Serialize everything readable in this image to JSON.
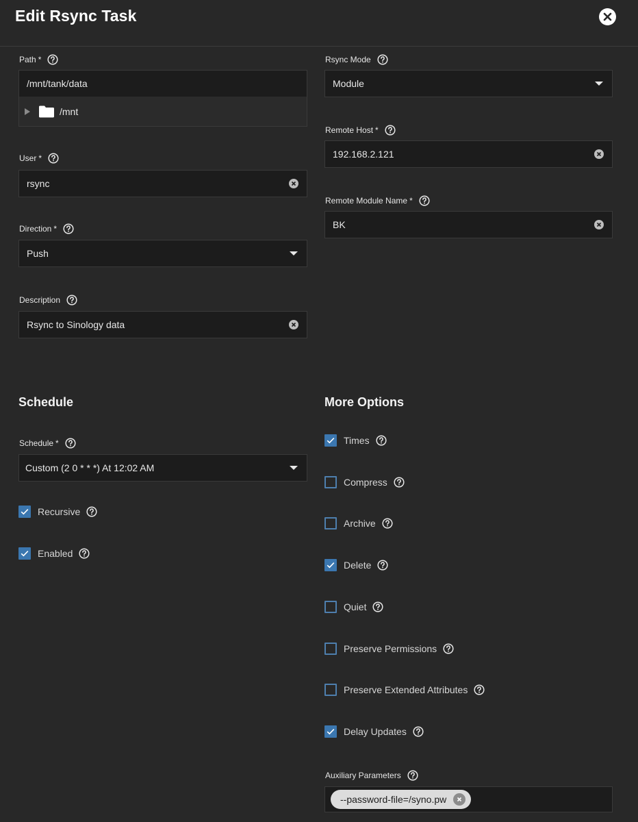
{
  "dialog": {
    "title": "Edit Rsync Task"
  },
  "left": {
    "path": {
      "label": "Path",
      "required": "*",
      "value": "/mnt/tank/data",
      "tree_node": "/mnt"
    },
    "user": {
      "label": "User",
      "required": "*",
      "value": "rsync"
    },
    "direction": {
      "label": "Direction",
      "required": "*",
      "value": "Push"
    },
    "description": {
      "label": "Description",
      "value": "Rsync to Sinology data"
    }
  },
  "right": {
    "rsync_mode": {
      "label": "Rsync Mode",
      "value": "Module"
    },
    "remote_host": {
      "label": "Remote Host",
      "required": "*",
      "value": "192.168.2.121"
    },
    "remote_module": {
      "label": "Remote Module Name",
      "required": "*",
      "value": "BK"
    }
  },
  "schedule": {
    "heading": "Schedule",
    "label": "Schedule",
    "required": "*",
    "value": "Custom (2 0 * * *) At 12:02 AM",
    "options": [
      {
        "label": "Recursive",
        "checked": true
      },
      {
        "label": "Enabled",
        "checked": true
      }
    ]
  },
  "more_options": {
    "heading": "More Options",
    "options": [
      {
        "label": "Times",
        "checked": true
      },
      {
        "label": "Compress",
        "checked": false
      },
      {
        "label": "Archive",
        "checked": false
      },
      {
        "label": "Delete",
        "checked": true
      },
      {
        "label": "Quiet",
        "checked": false
      },
      {
        "label": "Preserve Permissions",
        "checked": false
      },
      {
        "label": "Preserve Extended Attributes",
        "checked": false
      },
      {
        "label": "Delay Updates",
        "checked": true
      }
    ],
    "aux": {
      "label": "Auxiliary Parameters",
      "chip": "--password-file=/syno.pw"
    }
  },
  "colors": {
    "background": "#282828",
    "field": "#1c1c1c",
    "checkbox_accent": "#3b77b0"
  }
}
